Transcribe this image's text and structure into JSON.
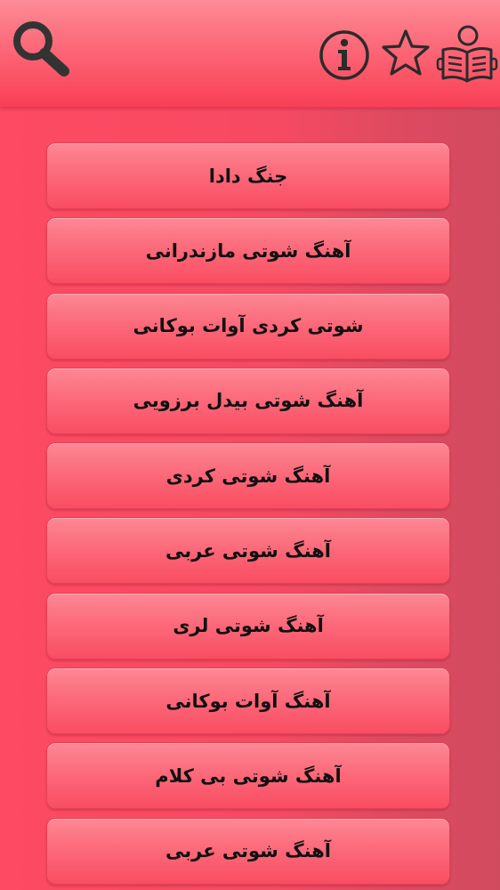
{
  "header": {
    "icons": {
      "search": "search-icon",
      "info": "info-icon",
      "favorites": "star-icon",
      "about": "reading-book-icon"
    }
  },
  "colors": {
    "background": "#fc4a62",
    "header_top": "#fd8c96",
    "header_bottom": "#f83f57",
    "item_top": "#fd8894",
    "item_bottom": "#f94d62",
    "icon_stroke": "#2b2b2b",
    "text": "#111111"
  },
  "items": [
    {
      "label": "جنگ دادا"
    },
    {
      "label": "آهنگ شوتی مازندرانی"
    },
    {
      "label": "شوتی کردی آوات بوکانی"
    },
    {
      "label": "آهنگ شوتی بیدل برزویی"
    },
    {
      "label": "آهنگ شوتی کردی"
    },
    {
      "label": "آهنگ شوتی عربی"
    },
    {
      "label": "آهنگ شوتی لری"
    },
    {
      "label": "آهنگ آوات بوکانی"
    },
    {
      "label": "آهنگ شوتی بی کلام"
    },
    {
      "label": "آهنگ شوتی عربی"
    }
  ]
}
